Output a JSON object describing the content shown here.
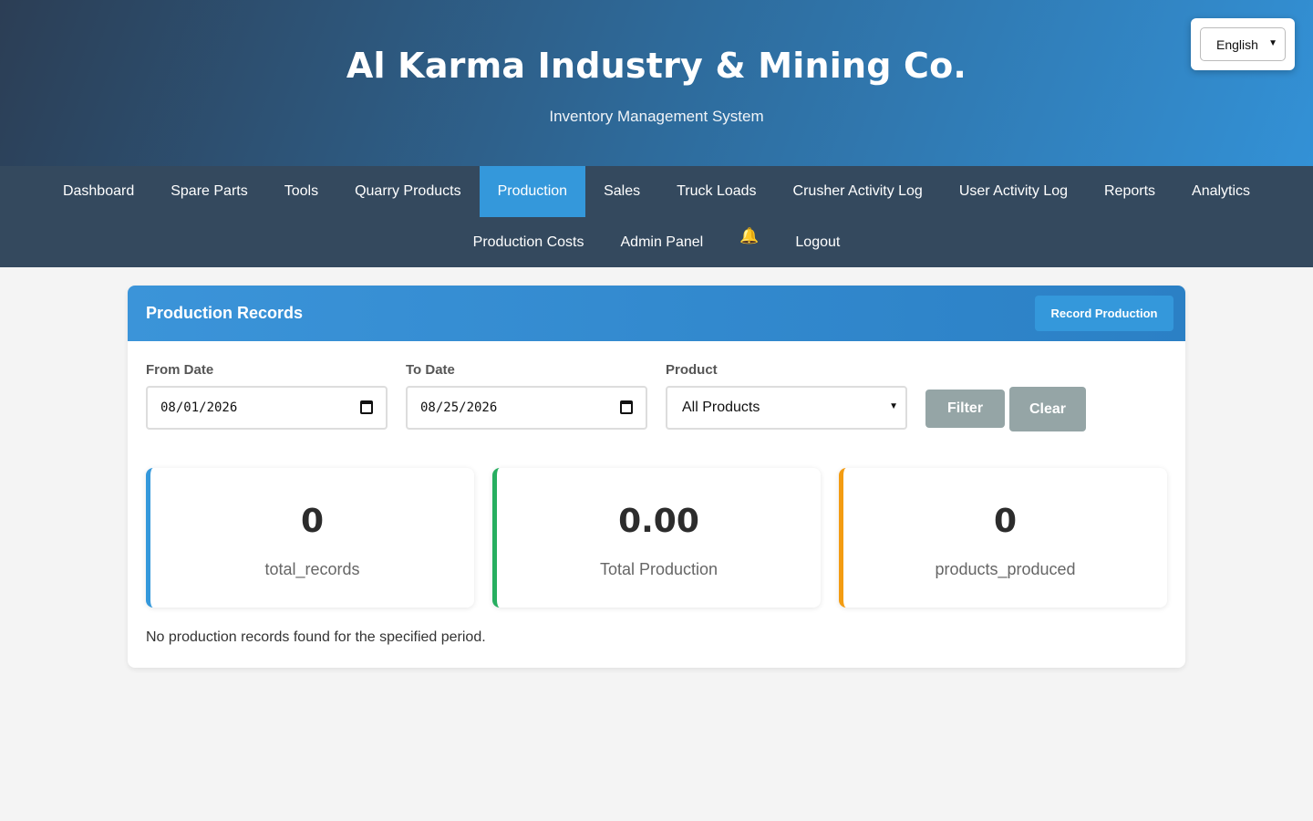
{
  "header": {
    "title": "Al Karma Industry & Mining Co.",
    "subtitle": "Inventory Management System"
  },
  "language": {
    "selected": "English"
  },
  "nav": {
    "row1": [
      "Dashboard",
      "Spare Parts",
      "Tools",
      "Quarry Products",
      "Production",
      "Sales",
      "Truck Loads",
      "Crusher Activity Log",
      "User Activity Log",
      "Reports",
      "Analytics"
    ],
    "row2": [
      "Production Costs",
      "Admin Panel",
      "Logout"
    ],
    "active": "Production"
  },
  "card": {
    "title": "Production Records",
    "record_button": "Record Production"
  },
  "filters": {
    "from_label": "From Date",
    "from_value": "08/01/2026",
    "to_label": "To Date",
    "to_value": "08/25/2026",
    "product_label": "Product",
    "product_value": "All Products",
    "filter_button": "Filter",
    "clear_button": "Clear"
  },
  "stats": [
    {
      "value": "0",
      "label": "total_records",
      "color": "#3498db"
    },
    {
      "value": "0.00",
      "label": "Total Production",
      "color": "#27ae60"
    },
    {
      "value": "0",
      "label": "products_produced",
      "color": "#f39c12"
    }
  ],
  "empty_message": "No production records found for the specified period.",
  "colors": {
    "nav_bg": "#34495e",
    "active_nav": "#3498db",
    "secondary_button": "#95a5a6"
  }
}
